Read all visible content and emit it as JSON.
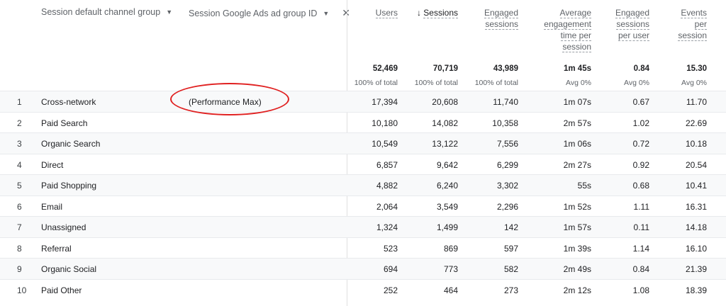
{
  "dimensions": {
    "primary": "Session default channel group",
    "secondary": "Session Google Ads ad group ID"
  },
  "metrics": [
    {
      "key": "users",
      "lines": [
        "Users"
      ],
      "sort": false
    },
    {
      "key": "sessions",
      "lines": [
        "Sessions"
      ],
      "sort": true
    },
    {
      "key": "engaged",
      "lines": [
        "Engaged",
        "sessions"
      ],
      "sort": false
    },
    {
      "key": "avgtime",
      "lines": [
        "Average",
        "engagement",
        "time per",
        "session"
      ],
      "sort": false
    },
    {
      "key": "engpu",
      "lines": [
        "Engaged",
        "sessions",
        "per user"
      ],
      "sort": false
    },
    {
      "key": "eps",
      "lines": [
        "Events",
        "per",
        "session"
      ],
      "sort": false
    }
  ],
  "totals": {
    "values": [
      "52,469",
      "70,719",
      "43,989",
      "1m 45s",
      "0.84",
      "15.30"
    ],
    "subs": [
      "100% of total",
      "100% of total",
      "100% of total",
      "Avg 0%",
      "Avg 0%",
      "Avg 0%"
    ]
  },
  "rows": [
    {
      "idx": "1",
      "channel": "Cross-network",
      "adgroup": "(Performance Max)",
      "values": [
        "17,394",
        "20,608",
        "11,740",
        "1m 07s",
        "0.67",
        "11.70"
      ]
    },
    {
      "idx": "2",
      "channel": "Paid Search",
      "adgroup": "",
      "values": [
        "10,180",
        "14,082",
        "10,358",
        "2m 57s",
        "1.02",
        "22.69"
      ]
    },
    {
      "idx": "3",
      "channel": "Organic Search",
      "adgroup": "",
      "values": [
        "10,549",
        "13,122",
        "7,556",
        "1m 06s",
        "0.72",
        "10.18"
      ]
    },
    {
      "idx": "4",
      "channel": "Direct",
      "adgroup": "",
      "values": [
        "6,857",
        "9,642",
        "6,299",
        "2m 27s",
        "0.92",
        "20.54"
      ]
    },
    {
      "idx": "5",
      "channel": "Paid Shopping",
      "adgroup": "",
      "values": [
        "4,882",
        "6,240",
        "3,302",
        "55s",
        "0.68",
        "10.41"
      ]
    },
    {
      "idx": "6",
      "channel": "Email",
      "adgroup": "",
      "values": [
        "2,064",
        "3,549",
        "2,296",
        "1m 52s",
        "1.11",
        "16.31"
      ]
    },
    {
      "idx": "7",
      "channel": "Unassigned",
      "adgroup": "",
      "values": [
        "1,324",
        "1,499",
        "142",
        "1m 57s",
        "0.11",
        "14.18"
      ]
    },
    {
      "idx": "8",
      "channel": "Referral",
      "adgroup": "",
      "values": [
        "523",
        "869",
        "597",
        "1m 39s",
        "1.14",
        "16.10"
      ]
    },
    {
      "idx": "9",
      "channel": "Organic Social",
      "adgroup": "",
      "values": [
        "694",
        "773",
        "582",
        "2m 49s",
        "0.84",
        "21.39"
      ]
    },
    {
      "idx": "10",
      "channel": "Paid Other",
      "adgroup": "",
      "values": [
        "252",
        "464",
        "273",
        "2m 12s",
        "1.08",
        "18.39"
      ]
    }
  ],
  "icons": {
    "caret": "caret-down-icon",
    "close": "close-icon",
    "sort": "arrow-down-icon"
  },
  "colors": {
    "highlight": "#e02020",
    "alt_row": "#f8f9fa"
  }
}
